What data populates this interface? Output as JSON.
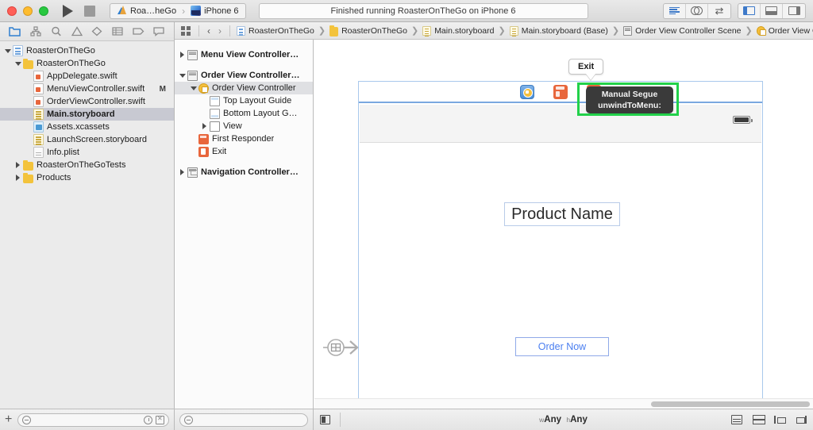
{
  "toolbar": {
    "run_label": "Run",
    "stop_label": "Stop",
    "scheme_project": "Roa…heGo",
    "scheme_separator": "›",
    "scheme_destination": "iPhone 6",
    "activity_status": "Finished running RoasterOnTheGo on iPhone 6",
    "view_buttons": [
      "standard-editor",
      "assistant-editor",
      "version-editor"
    ],
    "pane_buttons": [
      "navigator-toggle",
      "debug-area-toggle",
      "utilities-toggle"
    ]
  },
  "navigator": {
    "tabs": [
      "project-navigator",
      "symbol-navigator",
      "find-navigator",
      "issue-navigator",
      "test-navigator",
      "debug-navigator",
      "breakpoint-navigator",
      "report-navigator"
    ],
    "selected_tab": "project-navigator",
    "tree": [
      {
        "label": "RoasterOnTheGo",
        "icon": "project-icon",
        "depth": 0,
        "twisty": "down",
        "bold": false,
        "selected": false,
        "badge": ""
      },
      {
        "label": "RoasterOnTheGo",
        "icon": "folder-icon",
        "depth": 1,
        "twisty": "down",
        "bold": false,
        "selected": false,
        "badge": ""
      },
      {
        "label": "AppDelegate.swift",
        "icon": "swift-file-icon",
        "depth": 2,
        "twisty": "none",
        "bold": false,
        "selected": false,
        "badge": ""
      },
      {
        "label": "MenuViewController.swift",
        "icon": "swift-file-icon",
        "depth": 2,
        "twisty": "none",
        "bold": false,
        "selected": false,
        "badge": "M"
      },
      {
        "label": "OrderViewController.swift",
        "icon": "swift-file-icon",
        "depth": 2,
        "twisty": "none",
        "bold": false,
        "selected": false,
        "badge": ""
      },
      {
        "label": "Main.storyboard",
        "icon": "storyboard-icon",
        "depth": 2,
        "twisty": "none",
        "bold": true,
        "selected": true,
        "badge": ""
      },
      {
        "label": "Assets.xcassets",
        "icon": "assets-icon",
        "depth": 2,
        "twisty": "none",
        "bold": false,
        "selected": false,
        "badge": ""
      },
      {
        "label": "LaunchScreen.storyboard",
        "icon": "storyboard-icon",
        "depth": 2,
        "twisty": "none",
        "bold": false,
        "selected": false,
        "badge": ""
      },
      {
        "label": "Info.plist",
        "icon": "plist-icon",
        "depth": 2,
        "twisty": "none",
        "bold": false,
        "selected": false,
        "badge": ""
      },
      {
        "label": "RoasterOnTheGoTests",
        "icon": "folder-icon",
        "depth": 1,
        "twisty": "right",
        "bold": false,
        "selected": false,
        "badge": ""
      },
      {
        "label": "Products",
        "icon": "folder-icon",
        "depth": 1,
        "twisty": "right",
        "bold": false,
        "selected": false,
        "badge": ""
      }
    ],
    "bottom": {
      "add_label": "+",
      "filter_placeholder": ""
    }
  },
  "jumpbar": {
    "back_label": "‹",
    "forward_label": "›",
    "crumbs": [
      {
        "label": "RoasterOnTheGo",
        "icon": "project-icon"
      },
      {
        "label": "RoasterOnTheGo",
        "icon": "folder-icon"
      },
      {
        "label": "Main.storyboard",
        "icon": "storyboard-icon"
      },
      {
        "label": "Main.storyboard (Base)",
        "icon": "storyboard-icon"
      },
      {
        "label": "Order View Controller Scene",
        "icon": "scene-icon"
      },
      {
        "label": "Order View Controller",
        "icon": "view-controller-icon"
      }
    ]
  },
  "outline": {
    "rows": [
      {
        "label": "Menu View Controller…",
        "icon": "scene-icon",
        "indent": 0,
        "twisty": "right",
        "bold": true,
        "selected": false
      },
      {
        "label": "Order View Controller…",
        "icon": "scene-icon",
        "indent": 0,
        "twisty": "down",
        "bold": true,
        "selected": false
      },
      {
        "label": "Order View Controller",
        "icon": "view-controller-icon",
        "indent": 1,
        "twisty": "down",
        "bold": false,
        "selected": true
      },
      {
        "label": "Top Layout Guide",
        "icon": "top-layout-guide-icon",
        "indent": 2,
        "twisty": "none",
        "bold": false,
        "selected": false
      },
      {
        "label": "Bottom Layout G…",
        "icon": "bottom-layout-guide-icon",
        "indent": 2,
        "twisty": "none",
        "bold": false,
        "selected": false
      },
      {
        "label": "View",
        "icon": "view-icon",
        "indent": 2,
        "twisty": "right",
        "bold": false,
        "selected": false
      },
      {
        "label": "First Responder",
        "icon": "first-responder-icon",
        "indent": 1,
        "twisty": "none",
        "bold": false,
        "selected": false
      },
      {
        "label": "Exit",
        "icon": "exit-icon",
        "indent": 1,
        "twisty": "none",
        "bold": false,
        "selected": false
      },
      {
        "label": "Navigation Controller…",
        "icon": "navigation-controller-icon",
        "indent": 0,
        "twisty": "right",
        "bold": true,
        "selected": false
      }
    ],
    "bottom": {
      "filter_placeholder": ""
    }
  },
  "canvas": {
    "scene_dock_icons": [
      "view-controller-dock-icon",
      "first-responder-dock-icon",
      "exit-dock-icon"
    ],
    "exit_callout": "Exit",
    "segue_tooltip": {
      "kind": "Manual Segue",
      "identifier": "unwindToMenu:"
    },
    "product_label": "Product Name",
    "order_button": "Order Now",
    "entry_point": "storyboard-entry-point"
  },
  "editor_status": {
    "size_class_prefix_w": "w",
    "size_class_w": "Any",
    "size_class_prefix_h": "h",
    "size_class_h": "Any",
    "tools": [
      "auto-layout-resolver",
      "pin",
      "align",
      "stack"
    ]
  },
  "colors": {
    "accent_blue": "#3d79c9",
    "selection_green": "#22d14a",
    "tooltip_dark": "#3a3a3a",
    "sim_button_blue": "#4a7ef0",
    "frame_blue": "#a8c8ec"
  }
}
